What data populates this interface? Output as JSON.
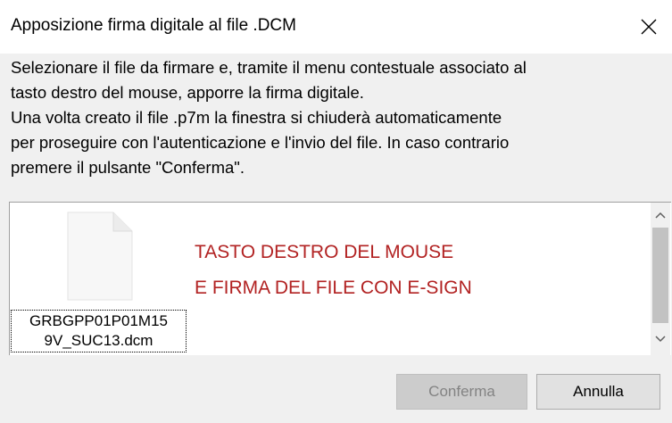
{
  "window": {
    "title": "Apposizione firma digitale al file .DCM",
    "close_icon": "close-icon"
  },
  "instructions": {
    "lines": [
      "Selezionare il file da firmare e, tramite il menu contestuale associato al",
      "tasto destro del mouse, apporre la firma digitale.",
      "Una volta creato il file .p7m la finestra si chiuderà automaticamente",
      "per proseguire con l'autenticazione e l'invio del file. In caso contrario",
      "premere il pulsante \"Conferma\"."
    ]
  },
  "file_list": {
    "items": [
      {
        "icon": "file-icon",
        "name_lines": [
          "GRBGPP01P01M15",
          "9V_SUC13.dcm"
        ]
      }
    ]
  },
  "hint": {
    "lines": [
      "TASTO DESTRO DEL MOUSE",
      "E FIRMA DEL FILE CON E-SIGN"
    ],
    "color": "#b22222"
  },
  "buttons": {
    "confirm_label": "Conferma",
    "confirm_enabled": false,
    "cancel_label": "Annulla"
  }
}
